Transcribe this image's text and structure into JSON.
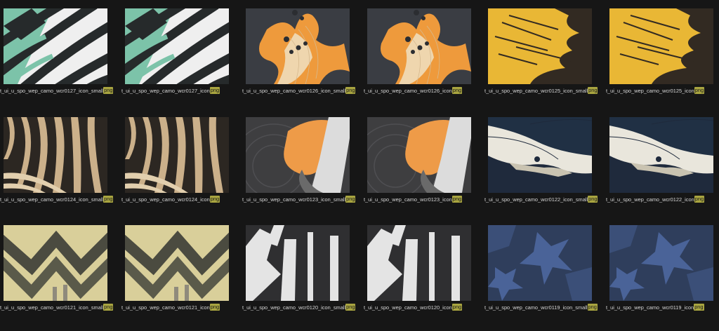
{
  "items": [
    {
      "name": "t_ui_u_spo_wep_camo_wcr0127_icon_small",
      "ext": "png",
      "pattern": "zebra-mint"
    },
    {
      "name": "t_ui_u_spo_wep_camo_wcr0127_icon",
      "ext": "png",
      "pattern": "zebra-mint"
    },
    {
      "name": "t_ui_u_spo_wep_camo_wcr0126_icon_small",
      "ext": "png",
      "pattern": "orange-blob"
    },
    {
      "name": "t_ui_u_spo_wep_camo_wcr0126_icon",
      "ext": "png",
      "pattern": "orange-blob"
    },
    {
      "name": "t_ui_u_spo_wep_camo_wcr0125_icon_small",
      "ext": "png",
      "pattern": "yellow-brush"
    },
    {
      "name": "t_ui_u_spo_wep_camo_wcr0125_icon",
      "ext": "png",
      "pattern": "yellow-brush"
    },
    {
      "name": "t_ui_u_spo_wep_camo_wcr0124_icon_small",
      "ext": "png",
      "pattern": "tan-swirl"
    },
    {
      "name": "t_ui_u_spo_wep_camo_wcr0124_icon",
      "ext": "png",
      "pattern": "tan-swirl"
    },
    {
      "name": "t_ui_u_spo_wep_camo_wcr0123_icon_small",
      "ext": "png",
      "pattern": "orange-gray"
    },
    {
      "name": "t_ui_u_spo_wep_camo_wcr0123_icon",
      "ext": "png",
      "pattern": "orange-gray"
    },
    {
      "name": "t_ui_u_spo_wep_camo_wcr0122_icon_small",
      "ext": "png",
      "pattern": "navy-wave"
    },
    {
      "name": "t_ui_u_spo_wep_camo_wcr0122_icon",
      "ext": "png",
      "pattern": "navy-wave"
    },
    {
      "name": "t_ui_u_spo_wep_camo_wcr0121_icon_small",
      "ext": "png",
      "pattern": "khaki-zigzag"
    },
    {
      "name": "t_ui_u_spo_wep_camo_wcr0121_icon",
      "ext": "png",
      "pattern": "khaki-zigzag"
    },
    {
      "name": "t_ui_u_spo_wep_camo_wcr0120_icon_small",
      "ext": "png",
      "pattern": "white-block"
    },
    {
      "name": "t_ui_u_spo_wep_camo_wcr0120_icon",
      "ext": "png",
      "pattern": "white-block"
    },
    {
      "name": "t_ui_u_spo_wep_camo_wcr0119_icon_small",
      "ext": "png",
      "pattern": "blue-star"
    },
    {
      "name": "t_ui_u_spo_wep_camo_wcr0119_icon",
      "ext": "png",
      "pattern": "blue-star"
    }
  ],
  "colors": {
    "background": "#161616",
    "badge": "#a9a540",
    "caption": "#d6d6d6"
  }
}
